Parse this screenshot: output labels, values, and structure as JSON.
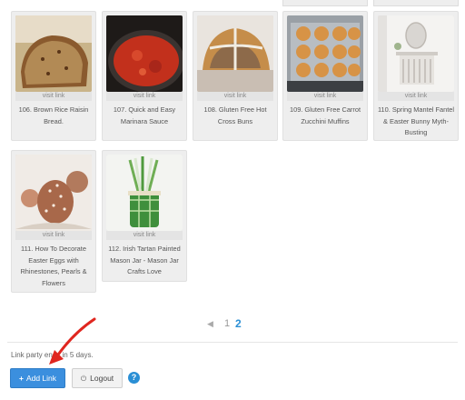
{
  "cards_row1": [
    {
      "caption": "106. Brown Rice Raisin Bread.",
      "visit": "visit link",
      "icon": "bread-photo"
    },
    {
      "caption": "107. Quick and Easy Marinara Sauce",
      "visit": "visit link",
      "icon": "sauce-photo"
    },
    {
      "caption": "108. Gluten Free Hot Cross Buns",
      "visit": "visit link",
      "icon": "buns-photo"
    },
    {
      "caption": "109. Gluten Free Carrot Zucchini Muffins",
      "visit": "visit link",
      "icon": "muffins-photo"
    },
    {
      "caption": "110. Spring Mantel Fantel & Easter Bunny Myth-Busting",
      "visit": "visit link",
      "icon": "mantel-photo"
    }
  ],
  "cards_row2": [
    {
      "caption": "111. How To Decorate Easter Eggs with Rhinestones, Pearls & Flowers",
      "visit": "visit link",
      "icon": "eggs-photo"
    },
    {
      "caption": "112. Irish Tartan Painted Mason Jar - Mason Jar Crafts Love",
      "visit": "visit link",
      "icon": "jar-photo"
    }
  ],
  "pagination": {
    "prev": "◀",
    "page1": "1",
    "page2": "2"
  },
  "footer": {
    "ends_text": "Link party ends in 5 days.",
    "add_link_label": "Add Link",
    "logout_label": "Logout",
    "help_label": "?"
  },
  "colors": {
    "accent": "#3b8fde",
    "arrow": "#e0261f"
  }
}
